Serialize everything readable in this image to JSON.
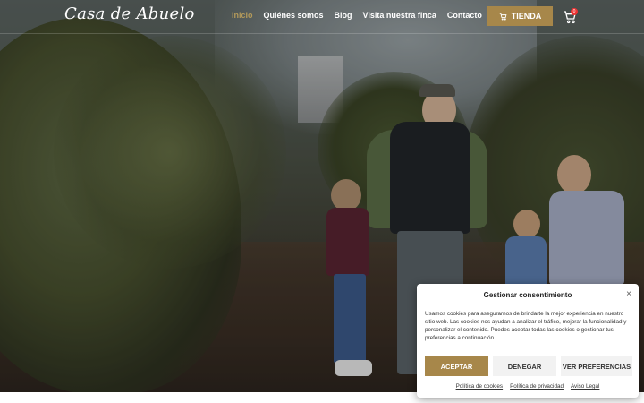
{
  "header": {
    "logo": "Casa de Abuelo",
    "nav": [
      "Inicio",
      "Quiénes somos",
      "Blog",
      "Visita nuestra finca",
      "Contacto"
    ],
    "active_nav": "Inicio",
    "shop_label": "TIENDA",
    "cart_count": "0",
    "icons": {
      "shop": "cart-icon",
      "cart": "cart-icon"
    }
  },
  "consent": {
    "title": "Gestionar consentimiento",
    "close": "×",
    "body": "Usamos cookies para asegurarnos de brindarte la mejor experiencia en nuestro sitio web. Las cookies nos ayudan a analizar el tráfico, mejorar la funcionalidad y personalizar el contenido. Puedes aceptar todas las cookies o gestionar tus preferencias a continuación.",
    "buttons": {
      "accept": "ACEPTAR",
      "deny": "DENEGAR",
      "preferences": "VER PREFERENCIAS"
    },
    "links": [
      "Política de cookies",
      "Política de privacidad",
      "Aviso Legal"
    ]
  },
  "colors": {
    "accent": "#a7874a",
    "active_nav": "#b49a5a",
    "badge": "#e33333"
  }
}
